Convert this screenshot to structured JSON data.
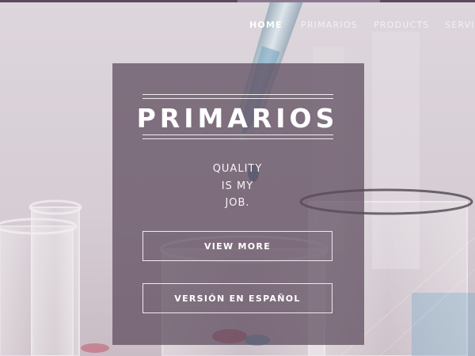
{
  "nav": {
    "items": [
      {
        "label": "HOME",
        "active": true
      },
      {
        "label": "PRIMARIOS",
        "active": false
      },
      {
        "label": "PRODUCTS",
        "active": false
      },
      {
        "label": "SERVIC",
        "active": false
      }
    ]
  },
  "hero": {
    "brand": "PRIMARIOS",
    "tagline": [
      "QUALITY",
      "IS MY",
      "JOB."
    ],
    "buttons": {
      "view_more": "VIEW MORE",
      "spanish": "VERSIÓN EN ESPAÑOL"
    },
    "overlay_color": "#5c4a5c",
    "background_color": "#d9d1d8",
    "accent_blue": "#4a9bc4",
    "accent_red": "#c0405a"
  }
}
